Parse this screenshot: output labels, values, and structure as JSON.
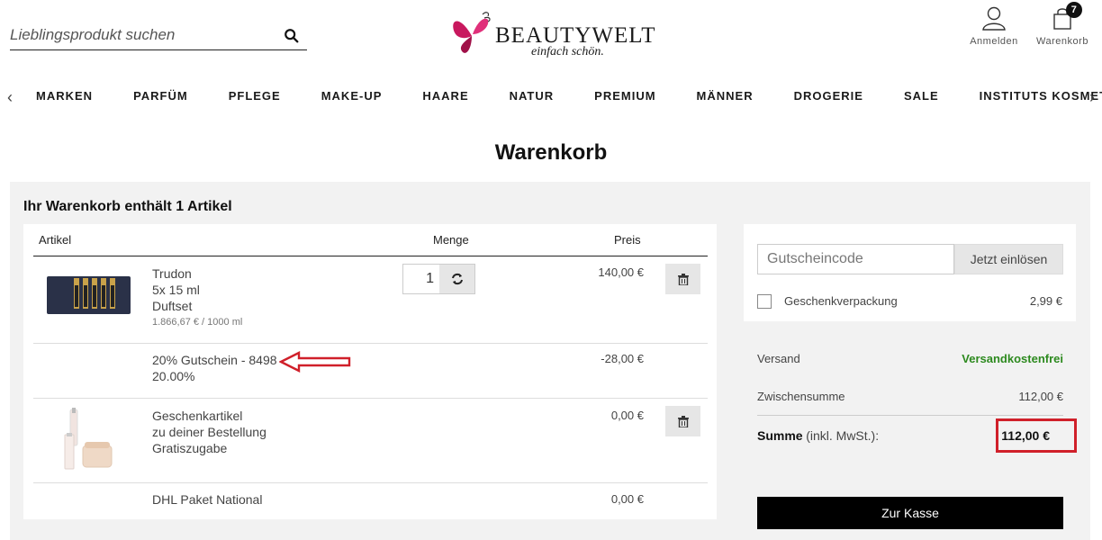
{
  "header": {
    "search": {
      "placeholder": "Lieblingsprodukt suchen"
    },
    "logo": {
      "name": "BEAUTYWELT",
      "tagline": "einfach schön."
    },
    "login_label": "Anmelden",
    "cart_label": "Warenkorb",
    "cart_count": "7"
  },
  "nav": {
    "items": [
      "MARKEN",
      "PARFÜM",
      "PFLEGE",
      "MAKE-UP",
      "HAARE",
      "NATUR",
      "PREMIUM",
      "MÄNNER",
      "DROGERIE",
      "SALE",
      "INSTITUTS KOSMETIK"
    ]
  },
  "page_title": "Warenkorb",
  "cart": {
    "heading": "Ihr Warenkorb enthält 1 Artikel",
    "columns": {
      "artikel": "Artikel",
      "menge": "Menge",
      "preis": "Preis"
    },
    "items": [
      {
        "name": "Trudon",
        "size": "5x 15 ml",
        "type": "Duftset",
        "unit_price": "1.866,67 € / 1000 ml",
        "quantity": "1",
        "price": "140,00 €"
      },
      {
        "name": "20% Gutschein - 8498",
        "detail": "20.00%",
        "price": "-28,00 €"
      },
      {
        "name": "Geschenkartikel",
        "detail1": "zu deiner Bestellung",
        "detail2": "Gratiszugabe",
        "price": "0,00 €"
      },
      {
        "name": "DHL Paket National",
        "price": "0,00 €"
      }
    ]
  },
  "voucher": {
    "placeholder": "Gutscheincode",
    "button": "Jetzt einlösen",
    "gift_wrap_label": "Geschenkverpackung",
    "gift_wrap_price": "2,99 €"
  },
  "summary": {
    "versand_label": "Versand",
    "versand_value": "Versandkostenfrei",
    "zwischensumme_label": "Zwischensumme",
    "zwischensumme_value": "112,00 €",
    "summe_label": "Summe",
    "summe_note": "(inkl. MwSt.):",
    "summe_value": "112,00 €"
  },
  "checkout_label": "Zur Kasse",
  "colors": {
    "accent_green": "#2d8a1f",
    "highlight_red": "#d0202a",
    "logo_pink": "#c8185e"
  }
}
